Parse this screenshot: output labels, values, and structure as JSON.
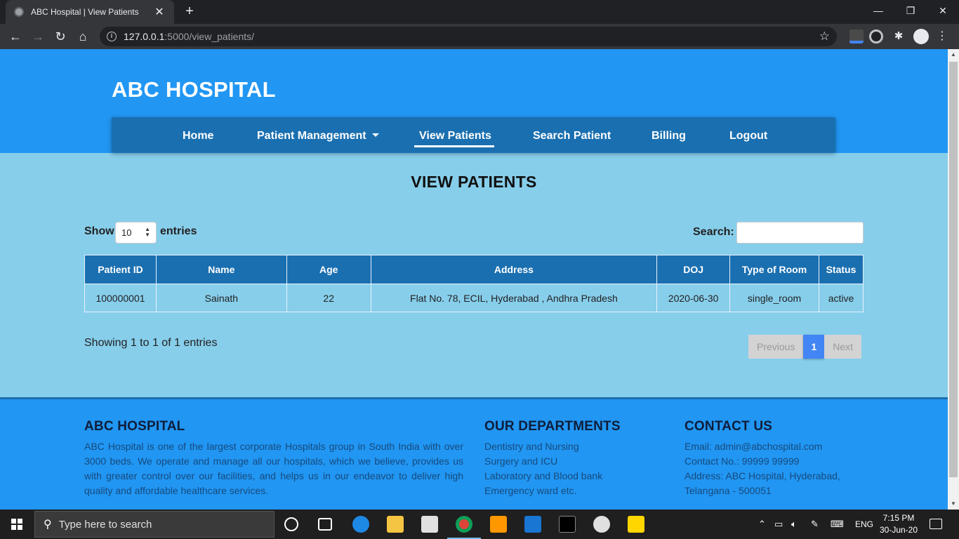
{
  "browser": {
    "tab_title": "ABC Hospital | View Patients",
    "url_host": "127.0.0.1",
    "url_path": ":5000/view_patients/"
  },
  "site": {
    "brand": "ABC HOSPITAL",
    "nav": {
      "home": "Home",
      "patient_management": "Patient Management",
      "view_patients": "View Patients",
      "search_patient": "Search Patient",
      "billing": "Billing",
      "logout": "Logout"
    },
    "page_title": "VIEW PATIENTS"
  },
  "table_controls": {
    "show_label": "Show",
    "entries_value": "10",
    "entries_label": "entries",
    "search_label": "Search:",
    "search_value": ""
  },
  "table": {
    "headers": [
      "Patient ID",
      "Name",
      "Age",
      "Address",
      "DOJ",
      "Type of Room",
      "Status"
    ],
    "rows": [
      [
        "100000001",
        "Sainath",
        "22",
        "Flat No. 78, ECIL, Hyderabad , Andhra Pradesh",
        "2020-06-30",
        "single_room",
        "active"
      ]
    ]
  },
  "pagination": {
    "info": "Showing 1 to 1 of 1 entries",
    "previous": "Previous",
    "current": "1",
    "next": "Next"
  },
  "footer": {
    "about_title": "ABC HOSPITAL",
    "about_text": "ABC Hospital is one of the largest corporate Hospitals group in South India with over 3000 beds. We operate and manage all our hospitals, which we believe, provides us with greater control over our facilities, and helps us in our endeavor to deliver high quality and affordable healthcare services.",
    "departments_title": "OUR DEPARTMENTS",
    "departments": [
      "Dentistry and Nursing",
      "Surgery and ICU",
      "Laboratory and Blood bank",
      "Emergency ward etc."
    ],
    "contact_title": "CONTACT US",
    "contact": [
      "Email: admin@abchospital.com",
      "Contact No.: 99999 99999",
      "Address: ABC Hospital, Hyderabad,",
      "Telangana - 500051"
    ]
  },
  "taskbar": {
    "search_placeholder": "Type here to search",
    "language": "ENG",
    "time": "7:15 PM",
    "date": "30-Jun-20"
  },
  "colors": {
    "header_blue": "#2196f3",
    "nav_blue": "#1a6fb0",
    "content_bg": "#87ceeb",
    "pager_active": "#4285f4"
  }
}
